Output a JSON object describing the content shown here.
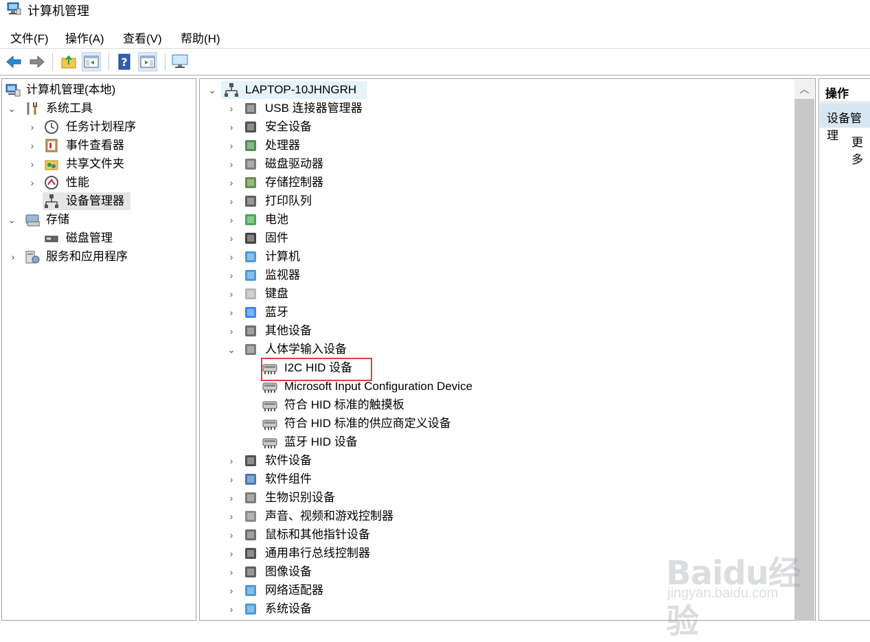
{
  "window": {
    "title": "计算机管理"
  },
  "menu": [
    "文件(F)",
    "操作(A)",
    "查看(V)",
    "帮助(H)"
  ],
  "toolbar_icons": [
    "back-arrow-icon",
    "forward-arrow-icon",
    "up-folder-icon",
    "show-hide-tree-icon",
    "help-icon",
    "show-hide-action-icon",
    "monitor-icon"
  ],
  "tree": {
    "root": "计算机管理(本地)",
    "items": [
      {
        "label": "系统工具"
      },
      {
        "label": "任务计划程序"
      },
      {
        "label": "事件查看器"
      },
      {
        "label": "共享文件夹"
      },
      {
        "label": "性能"
      },
      {
        "label": "设备管理器"
      },
      {
        "label": "存储"
      },
      {
        "label": "磁盘管理"
      },
      {
        "label": "服务和应用程序"
      }
    ]
  },
  "devices": {
    "computer": "LAPTOP-10JHNGRH",
    "categories": [
      "USB 连接器管理器",
      "安全设备",
      "处理器",
      "磁盘驱动器",
      "存储控制器",
      "打印队列",
      "电池",
      "固件",
      "计算机",
      "监视器",
      "键盘",
      "蓝牙",
      "其他设备",
      "人体学输入设备"
    ],
    "hid_children": [
      "I2C HID 设备",
      "Microsoft Input Configuration Device",
      "符合 HID 标准的触摸板",
      "符合 HID 标准的供应商定义设备",
      "蓝牙 HID 设备"
    ],
    "categories_after": [
      "软件设备",
      "软件组件",
      "生物识别设备",
      "声音、视频和游戏控制器",
      "鼠标和其他指针设备",
      "通用串行总线控制器",
      "图像设备",
      "网络适配器",
      "系统设备"
    ]
  },
  "actions": {
    "title": "操作",
    "section": "设备管理",
    "more": "更多"
  },
  "watermark": {
    "brand": "Baidu经验",
    "url": "jingyan.baidu.com"
  }
}
